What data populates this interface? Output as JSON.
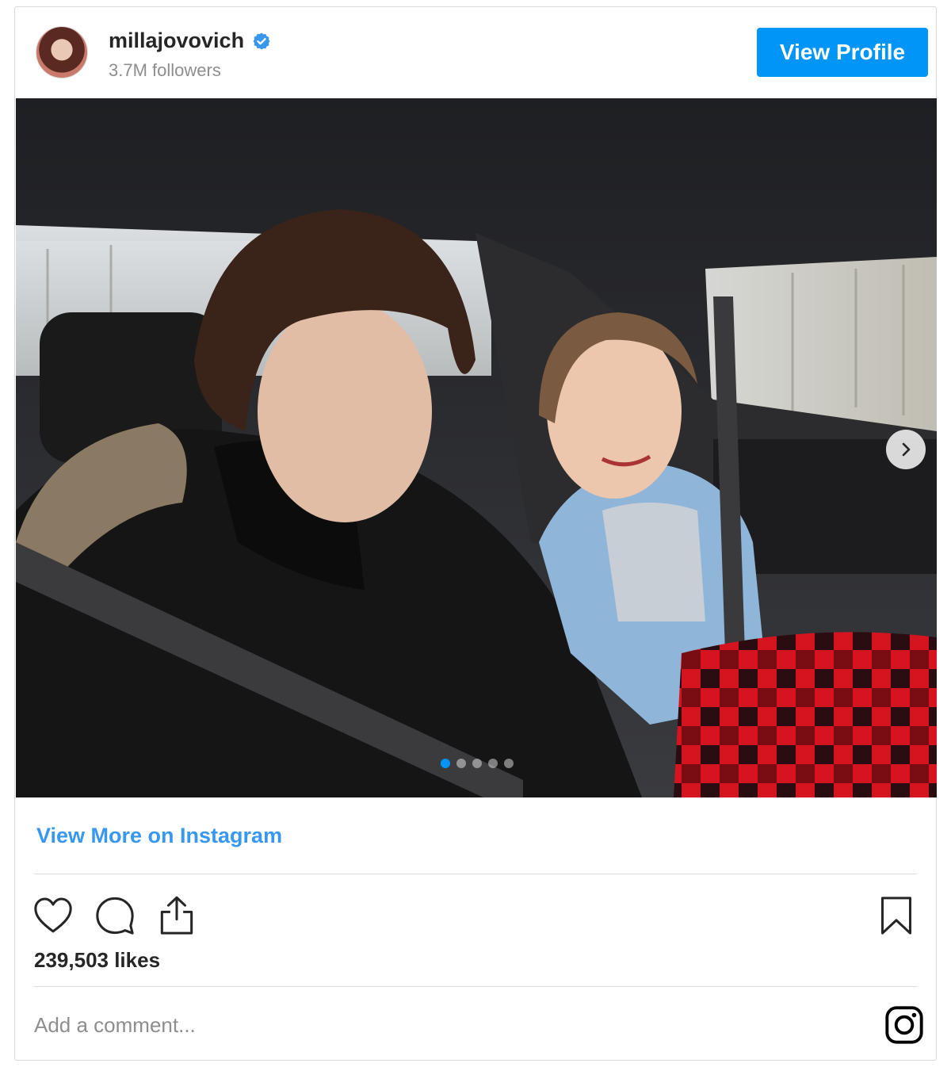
{
  "header": {
    "username": "millajovovich",
    "verified": true,
    "followers": "3.7M followers",
    "view_profile_label": "View Profile"
  },
  "post": {
    "image_alt": "",
    "carousel": {
      "count": 5,
      "active_index": 0
    },
    "view_more_label": "View More on Instagram",
    "likes": "239,503 likes",
    "comment_placeholder": "Add a comment..."
  },
  "icons": [
    "verified-badge-icon",
    "chevron-right-icon",
    "heart-icon",
    "comment-icon",
    "share-icon",
    "bookmark-icon",
    "instagram-icon"
  ],
  "colors": {
    "accent": "#0095f6",
    "link": "#3897f0",
    "muted": "#8e8e8e",
    "text": "#262626",
    "border": "#dbdbdb"
  }
}
